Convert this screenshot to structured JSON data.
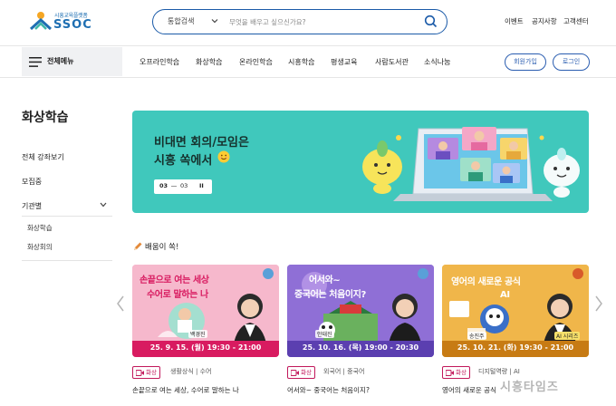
{
  "header": {
    "logo_small": "시흥교육플랫폼",
    "logo_big": "SSOC",
    "search_category": "통합검색",
    "search_placeholder": "무엇을 배우고 싶으신가요?",
    "utility_links": [
      "이벤트",
      "공지사항",
      "고객센터"
    ]
  },
  "nav": {
    "all_menu": "전체메뉴",
    "items": [
      "오프라인학습",
      "화상학습",
      "온라인학습",
      "시흥학습",
      "평생교육",
      "사람도서관",
      "소식나눔"
    ],
    "signup": "회원가입",
    "login": "로그인"
  },
  "sidebar": {
    "title": "화상학습",
    "items": [
      "전체 강좌보기",
      "모집중",
      "기관별"
    ],
    "sub_items": [
      "화상학습",
      "화상회의"
    ]
  },
  "banner": {
    "line1": "비대면 회의/모임은",
    "line2": "시흥 쏙에서",
    "slide_current": "03",
    "slide_total": "03",
    "pause_symbol": "II"
  },
  "section": {
    "title": "배움이 쏙!"
  },
  "cards": [
    {
      "thumb_title_1": "손끝으로 여는 세상",
      "thumb_title_2": "수어로 말하는 나",
      "instructor": "백경진",
      "date": "25. 9. 15. (월) 19:30 - 21:00",
      "badge": "화상",
      "categories": "생활상식 | 수어",
      "title": "손끝으로 여는 세상, 수어로 말하는 나",
      "bg": "#f6b8cc"
    },
    {
      "thumb_title_1": "어서와~",
      "thumb_title_2": "중국어는 처음이지?",
      "instructor": "안태진",
      "date": "25. 10. 16. (목) 19:00 - 20:30",
      "badge": "화상",
      "categories": "외국어 | 중국어",
      "title": "어서와~ 중국어는 처음이지?",
      "bg": "#8f6fd6"
    },
    {
      "thumb_title_1": "영어의 새로운 공식",
      "thumb_title_2": "AI",
      "instructor": "송진주",
      "speaker_tag": "AI 시리즈",
      "date": "25. 10. 21. (화) 19:30 - 21:00",
      "badge": "화상",
      "categories": "디지털역량 | AI",
      "title": "영어의 새로운 공식",
      "bg": "#f0b64a"
    }
  ],
  "watermark": "시흥타임즈",
  "colors": {
    "brand_blue": "#1a5aa8",
    "banner_teal": "#40c8bc",
    "badge_pink": "#c2185b"
  }
}
